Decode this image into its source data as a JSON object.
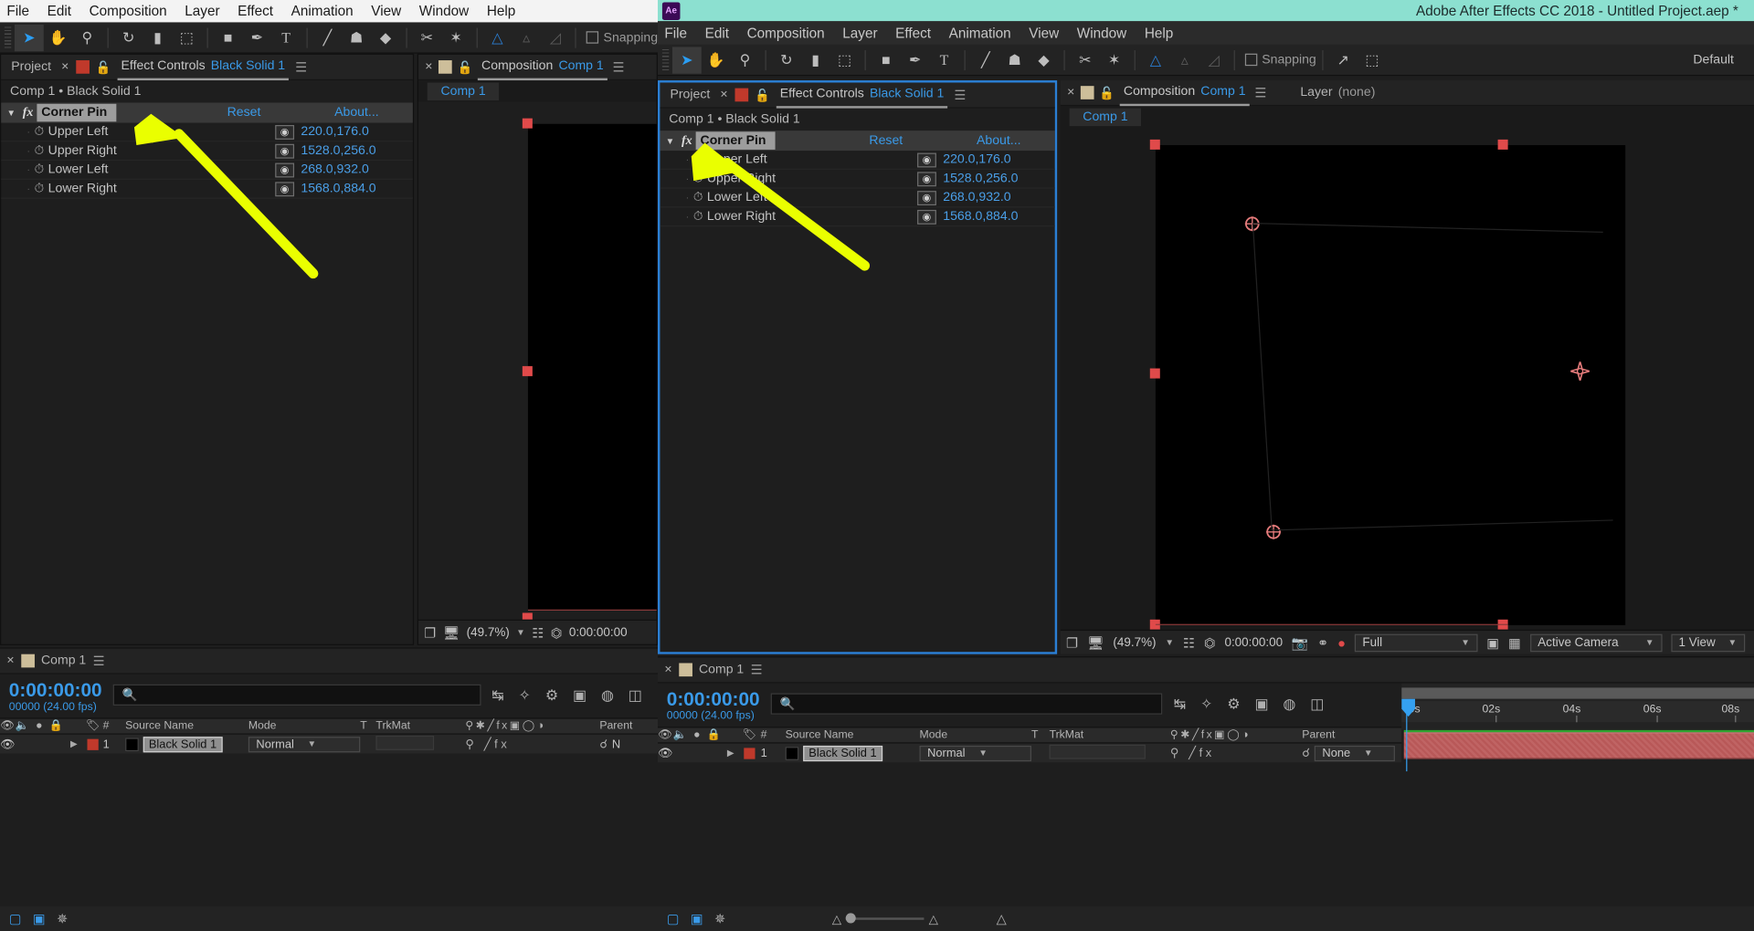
{
  "app": {
    "title": "Adobe After Effects CC 2018 - Untitled Project.aep *",
    "icon_label": "Ae",
    "titlebar_color": "#8ce0d0",
    "workspace_label": "Default"
  },
  "menu": {
    "items": [
      "File",
      "Edit",
      "Composition",
      "Layer",
      "Effect",
      "Animation",
      "View",
      "Window",
      "Help"
    ]
  },
  "toolbar": {
    "snapping_label": "Snapping",
    "tools": [
      {
        "name": "selection-tool",
        "glyph": "➤"
      },
      {
        "name": "hand-tool",
        "glyph": "✋"
      },
      {
        "name": "zoom-tool",
        "glyph": "⚲"
      },
      {
        "name": "rotation-tool",
        "glyph": "↺"
      },
      {
        "name": "camera-tool",
        "glyph": "▰"
      },
      {
        "name": "pan-behind-tool",
        "glyph": "⬚"
      },
      {
        "name": "shape-tool",
        "glyph": "■"
      },
      {
        "name": "pen-tool",
        "glyph": "✒"
      },
      {
        "name": "type-tool",
        "glyph": "T"
      },
      {
        "name": "brush-tool",
        "glyph": "╱"
      },
      {
        "name": "clone-stamp-tool",
        "glyph": "☗"
      },
      {
        "name": "eraser-tool",
        "glyph": "◆"
      },
      {
        "name": "roto-brush-tool",
        "glyph": "✄"
      },
      {
        "name": "puppet-pin-tool",
        "glyph": "✶"
      }
    ]
  },
  "panels": {
    "project_tab": "Project",
    "effect_controls_tab": "Effect Controls",
    "effect_controls_target": "Black Solid 1",
    "composition_tab": "Composition",
    "composition_target": "Comp 1",
    "layer_tab": "Layer",
    "layer_target": "(none)"
  },
  "effect_controls": {
    "breadcrumb": "Comp 1 • Black Solid 1",
    "effect_name": "Corner Pin",
    "reset_label": "Reset",
    "about_label": "About...",
    "properties": [
      {
        "label": "Upper Left",
        "value": "220.0,176.0"
      },
      {
        "label": "Upper Right",
        "value": "1528.0,256.0"
      },
      {
        "label": "Lower Left",
        "value": "268.0,932.0"
      },
      {
        "label": "Lower Right",
        "value": "1568.0,884.0"
      }
    ]
  },
  "composition": {
    "view_tab": "Comp 1",
    "zoom": "(49.7%)",
    "timecode": "0:00:00:00",
    "resolution": "Full",
    "camera": "Active Camera",
    "views": "1 View"
  },
  "timeline": {
    "tab_label": "Comp 1",
    "timecode": "0:00:00:00",
    "frames_label": "00000 (24.00 fps)",
    "search_placeholder": "",
    "columns": [
      "#",
      "Source Name",
      "Mode",
      "T",
      "TrkMat",
      "Parent"
    ],
    "rows": [
      {
        "index": "1",
        "source_name": "Black Solid 1",
        "mode": "Normal",
        "trkmat": "",
        "parent": "None"
      }
    ],
    "ruler_ticks": [
      "0s",
      "02s",
      "04s",
      "06s",
      "08s"
    ]
  },
  "annotation": {
    "color": "#eaff00",
    "description": "hand-drawn arrow pointing at Corner Pin effect name"
  }
}
